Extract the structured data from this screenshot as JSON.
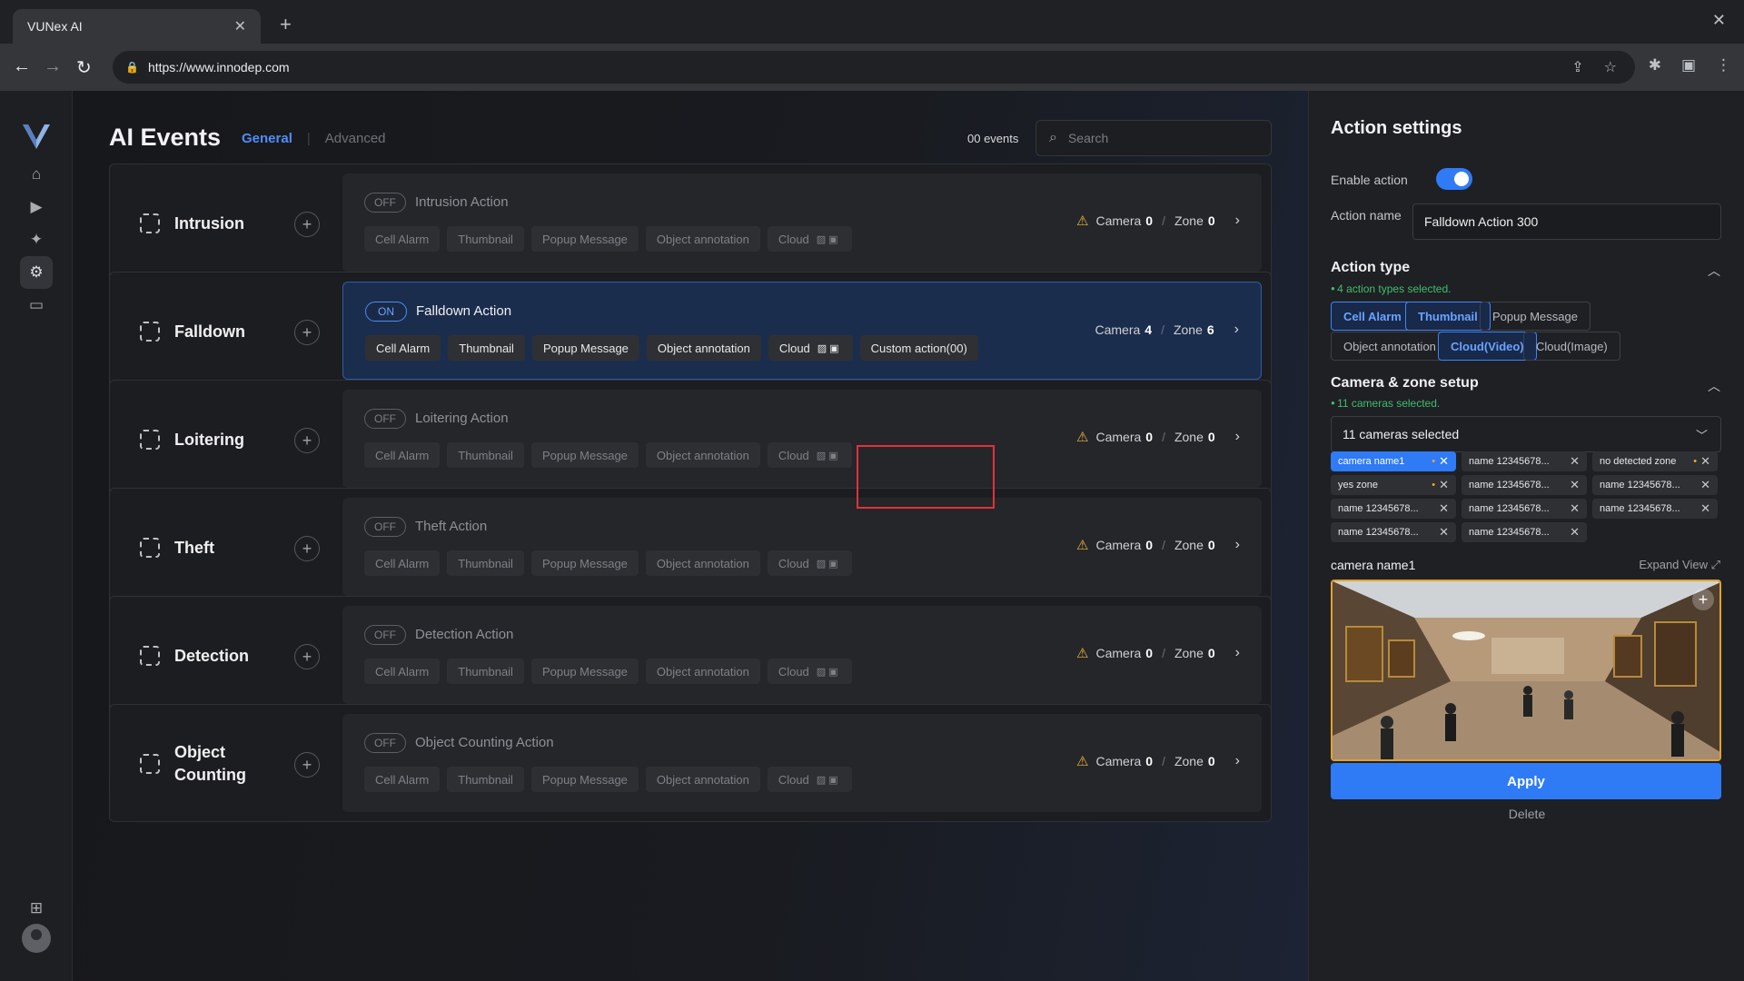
{
  "browser": {
    "tab_title": "VUNex AI",
    "url": "https://www.innodep.com"
  },
  "header": {
    "title": "AI Events",
    "tab_general": "General",
    "tab_advanced": "Advanced",
    "event_count": "00 events",
    "search_placeholder": "Search"
  },
  "events": [
    {
      "name": "Intrusion",
      "status": "OFF",
      "action": "Intrusion Action",
      "camera": "0",
      "zone": "0",
      "warn": true,
      "selected": false,
      "chips": [
        "Cell Alarm",
        "Thumbnail",
        "Popup Message",
        "Object annotation",
        "Cloud"
      ]
    },
    {
      "name": "Falldown",
      "status": "ON",
      "action": "Falldown Action",
      "camera": "4",
      "zone": "6",
      "warn": false,
      "selected": true,
      "chips": [
        "Cell Alarm",
        "Thumbnail",
        "Popup Message",
        "Object annotation",
        "Cloud",
        "Custom action(00)"
      ]
    },
    {
      "name": "Loitering",
      "status": "OFF",
      "action": "Loitering Action",
      "camera": "0",
      "zone": "0",
      "warn": true,
      "selected": false,
      "chips": [
        "Cell Alarm",
        "Thumbnail",
        "Popup Message",
        "Object annotation",
        "Cloud"
      ]
    },
    {
      "name": "Theft",
      "status": "OFF",
      "action": "Theft Action",
      "camera": "0",
      "zone": "0",
      "warn": true,
      "selected": false,
      "chips": [
        "Cell Alarm",
        "Thumbnail",
        "Popup Message",
        "Object annotation",
        "Cloud"
      ]
    },
    {
      "name": "Detection",
      "status": "OFF",
      "action": "Detection Action",
      "camera": "0",
      "zone": "0",
      "warn": true,
      "selected": false,
      "chips": [
        "Cell Alarm",
        "Thumbnail",
        "Popup Message",
        "Object annotation",
        "Cloud"
      ]
    },
    {
      "name": "Object Counting",
      "status": "OFF",
      "action": "Object Counting Action",
      "camera": "0",
      "zone": "0",
      "warn": true,
      "selected": false,
      "chips": [
        "Cell Alarm",
        "Thumbnail",
        "Popup Message",
        "Object annotation",
        "Cloud"
      ]
    }
  ],
  "labels": {
    "camera": "Camera",
    "zone": "Zone"
  },
  "panel": {
    "title": "Action settings",
    "enable_label": "Enable action",
    "enable_on": true,
    "name_label": "Action name",
    "name_value": "Falldown Action 300",
    "action_type_title": "Action type",
    "action_type_hint": "4 action types selected.",
    "action_types": [
      {
        "label": "Cell Alarm",
        "on": true
      },
      {
        "label": "Thumbnail",
        "on": true
      },
      {
        "label": "Popup Message",
        "on": false
      },
      {
        "label": "Object annotation",
        "on": false
      },
      {
        "label": "Cloud(Video)",
        "on": true
      },
      {
        "label": "Cloud(Image)",
        "on": false
      }
    ],
    "camera_title": "Camera & zone setup",
    "camera_hint": "11 cameras selected.",
    "camera_dropdown": "11 cameras selected",
    "camera_tags": [
      {
        "label": "camera name1",
        "on": true,
        "dot": true
      },
      {
        "label": "name 12345678...",
        "on": false,
        "dot": false
      },
      {
        "label": "no detected zone",
        "on": false,
        "dot": true
      },
      {
        "label": "yes zone",
        "on": false,
        "dot": true
      },
      {
        "label": "name 12345678...",
        "on": false,
        "dot": false
      },
      {
        "label": "name 12345678...",
        "on": false,
        "dot": false
      },
      {
        "label": "name 12345678...",
        "on": false,
        "dot": false
      },
      {
        "label": "name 12345678...",
        "on": false,
        "dot": false
      },
      {
        "label": "name 12345678...",
        "on": false,
        "dot": false
      },
      {
        "label": "name 12345678...",
        "on": false,
        "dot": false
      },
      {
        "label": "name 12345678...",
        "on": false,
        "dot": false
      }
    ],
    "preview_camera": "camera name1",
    "expand_view": "Expand View",
    "apply": "Apply",
    "delete": "Delete"
  }
}
